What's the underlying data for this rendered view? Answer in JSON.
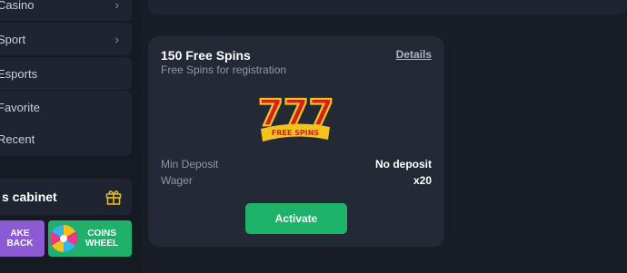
{
  "sidebar": {
    "items": [
      {
        "label": "Casino",
        "icon": "chevron-right-icon"
      },
      {
        "label": "Sport",
        "icon": "chevron-right-icon"
      },
      {
        "label": "Esports"
      },
      {
        "label": "Favorite"
      },
      {
        "label": "Recent"
      }
    ],
    "cabinet": {
      "label": "s cabinet",
      "icon": "gift-icon"
    },
    "promos": [
      {
        "label": "AKE BACK",
        "color": "#8b5bd6"
      },
      {
        "label": "COINS\nWHEEL",
        "color": "#1fb16b",
        "icon": "fortune-wheel-icon"
      }
    ]
  },
  "offer": {
    "title": "150 Free Spins",
    "subtitle": "Free Spins for registration",
    "details_label": "Details",
    "badge": {
      "number": "777",
      "text": "FREE SPINS"
    },
    "rows": [
      {
        "label": "Min Deposit",
        "value": "No deposit"
      },
      {
        "label": "Wager",
        "value": "x20"
      }
    ],
    "activate_label": "Activate"
  },
  "colors": {
    "background": "#181d26",
    "card": "#232a36",
    "accent_green": "#1db46a",
    "accent_purple": "#8b5bd6"
  }
}
